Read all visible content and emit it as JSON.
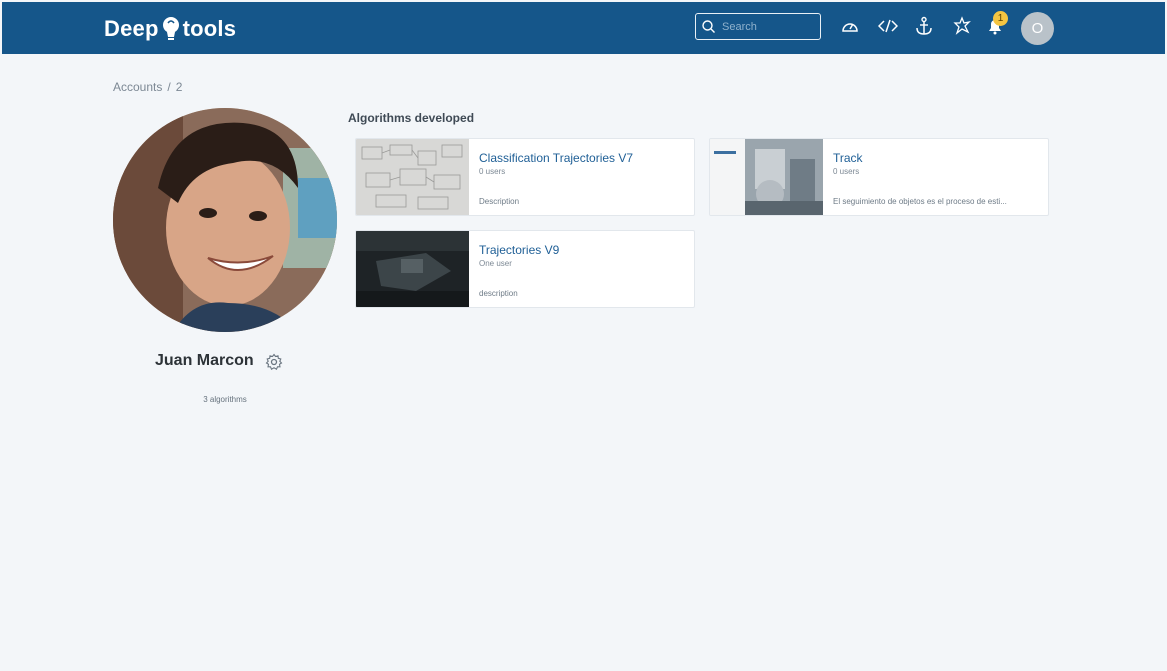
{
  "header": {
    "logo_left": "Deep",
    "logo_right": "tools",
    "search_placeholder": "Search",
    "notification_count": "1",
    "user_initial": "O"
  },
  "breadcrumb": {
    "root": "Accounts",
    "separator": "/",
    "current": "2"
  },
  "profile": {
    "name": "Juan Marcon",
    "algorithm_count": "3 algorithms"
  },
  "section": {
    "title": "Algorithms developed"
  },
  "algorithms": [
    {
      "title": "Classification Trajectories V7",
      "users": "0 users",
      "description": "Description"
    },
    {
      "title": "Track",
      "users": "0 users",
      "description": "El seguimiento de objetos es el proceso de esti..."
    },
    {
      "title": "Trajectories V9",
      "users": "One user",
      "description": "description"
    }
  ],
  "colors": {
    "header_bg": "#15568a",
    "link": "#1f5f96",
    "page_bg": "#f3f6f9",
    "badge": "#f4c542"
  }
}
